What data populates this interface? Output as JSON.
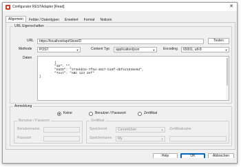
{
  "window": {
    "title": "Configurator RESTAdapter [Read]",
    "close_glyph": "✕"
  },
  "tabs": [
    {
      "label": "Allgemein",
      "active": true
    },
    {
      "label": "Felder / Datentypen"
    },
    {
      "label": "Erweitert"
    },
    {
      "label": "Format"
    },
    {
      "label": "Notizen"
    }
  ],
  "url_group": {
    "title": "URL Eigenschaften",
    "url_label": "URL",
    "url_value": "https://localhost/api/StoreID",
    "test_button": "Testen",
    "method_label": "Methode",
    "method_value": "POST",
    "content_type_label": "Content Typ",
    "content_type_value": "application/json",
    "encoding_label": "Encoding",
    "encoding_value": "65001, utf-8",
    "data_label": "Daten",
    "data_value": "{\n        \"ID\": \"\",\n        \"GUID\": \"374ebb34-7f5d-4817-b18f-dbfe21638e9d\",\n        \"Text\": \"ABC 123 def\"\n}"
  },
  "login_group": {
    "title": "Anmeldung",
    "radio_none": "Keine",
    "radio_user_password": "Benutzer / Passwort",
    "radio_certificate": "Zertifikat",
    "selected": "Keine",
    "user_pw_title": "Benutzer / Passwort",
    "username_label": "Benutzername",
    "password_label": "Passwort",
    "cert_title": "Zertifikat",
    "store_label": "Speicherort",
    "store_value": "CurrentUser",
    "store_name_label": "Speichername",
    "store_name_value": "My",
    "cert_name_label": "Zertifikatname"
  },
  "footer": {
    "help": "Help",
    "ok": "OK",
    "cancel": "Abbrechen"
  },
  "colors": {
    "accent": "#0067c0",
    "app_icon": "#d23a2a"
  }
}
